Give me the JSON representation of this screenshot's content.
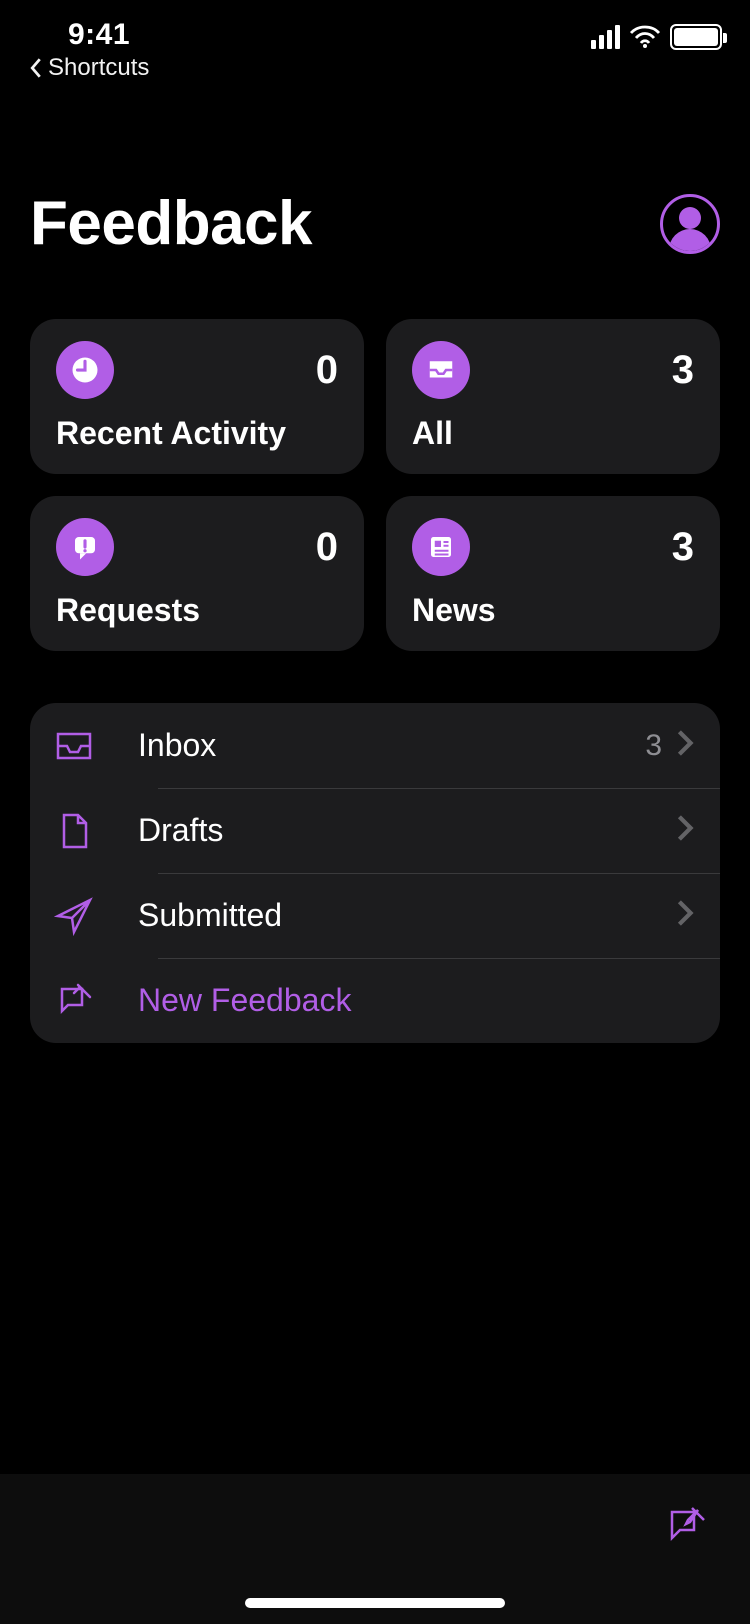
{
  "status": {
    "time": "9:41",
    "back_app_label": "Shortcuts"
  },
  "header": {
    "title": "Feedback"
  },
  "tiles": {
    "recent": {
      "label": "Recent Activity",
      "count": "0"
    },
    "all": {
      "label": "All",
      "count": "3"
    },
    "requests": {
      "label": "Requests",
      "count": "0"
    },
    "news": {
      "label": "News",
      "count": "3"
    }
  },
  "list": {
    "inbox": {
      "label": "Inbox",
      "count": "3"
    },
    "drafts": {
      "label": "Drafts"
    },
    "submitted": {
      "label": "Submitted"
    },
    "new_feedback": {
      "label": "New Feedback"
    }
  },
  "accent_color": "#b15ee6"
}
